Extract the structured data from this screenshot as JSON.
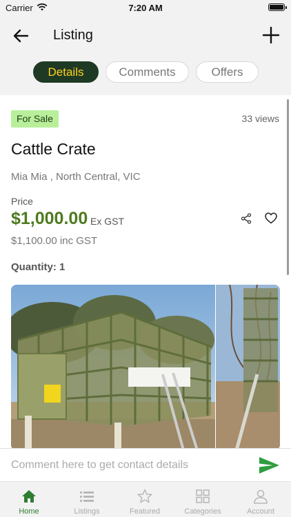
{
  "status_bar": {
    "carrier": "Carrier",
    "time": "7:20 AM"
  },
  "header": {
    "title": "Listing"
  },
  "tabs": [
    {
      "label": "Details",
      "active": true
    },
    {
      "label": "Comments",
      "active": false
    },
    {
      "label": "Offers",
      "active": false
    }
  ],
  "listing": {
    "badge": "For Sale",
    "views": "33 views",
    "title": "Cattle Crate",
    "location": "Mia Mia , North Central, VIC",
    "price_label": "Price",
    "price": "$1,000.00",
    "price_suffix": "Ex GST",
    "price_inc": "$1,100.00 inc GST",
    "quantity": "Quantity: 1"
  },
  "comment": {
    "placeholder": "Comment here to get contact details"
  },
  "bottom_nav": [
    {
      "label": "Home",
      "icon": "home-icon",
      "active": true
    },
    {
      "label": "Listings",
      "icon": "list-icon",
      "active": false
    },
    {
      "label": "Featured",
      "icon": "star-icon",
      "active": false
    },
    {
      "label": "Categories",
      "icon": "grid-icon",
      "active": false
    },
    {
      "label": "Account",
      "icon": "person-icon",
      "active": false
    }
  ],
  "colors": {
    "accent_green": "#4e7a1f",
    "active_tab_bg": "#1f3a24",
    "active_tab_text": "#ffd21f",
    "badge_bg": "#b9ef9b",
    "send_green": "#2e9e3e"
  }
}
